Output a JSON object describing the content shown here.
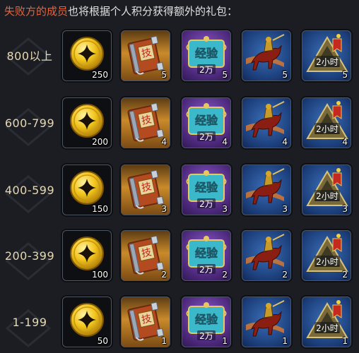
{
  "header": {
    "highlight": "失败方的成员",
    "rest": "也将根据个人积分获得额外的礼包："
  },
  "exp_label": {
    "top": "经验",
    "bottom": "2万"
  },
  "time_label": "2小时",
  "book_glyph": "技",
  "colors": {
    "highlight": "#e8623a",
    "range_text": "#e6d8b3",
    "coin_gold": "#f2c51c",
    "book_orange": "#c98a2a",
    "exp_purple": "#6b3aa8",
    "tile_blue": "#1c3e7a"
  },
  "icons": [
    "coin-icon",
    "skill-book-icon",
    "exp-scroll-icon",
    "war-horse-icon",
    "time-flag-icon"
  ],
  "rows": [
    {
      "range": "800以上",
      "counts": [
        "250",
        "5",
        "5",
        "5",
        "5"
      ]
    },
    {
      "range": "600-799",
      "counts": [
        "200",
        "4",
        "4",
        "4",
        "4"
      ]
    },
    {
      "range": "400-599",
      "counts": [
        "150",
        "3",
        "3",
        "3",
        "3"
      ]
    },
    {
      "range": "200-399",
      "counts": [
        "100",
        "2",
        "2",
        "2",
        "2"
      ]
    },
    {
      "range": "1-199",
      "counts": [
        "50",
        "1",
        "1",
        "1",
        "1"
      ]
    }
  ]
}
